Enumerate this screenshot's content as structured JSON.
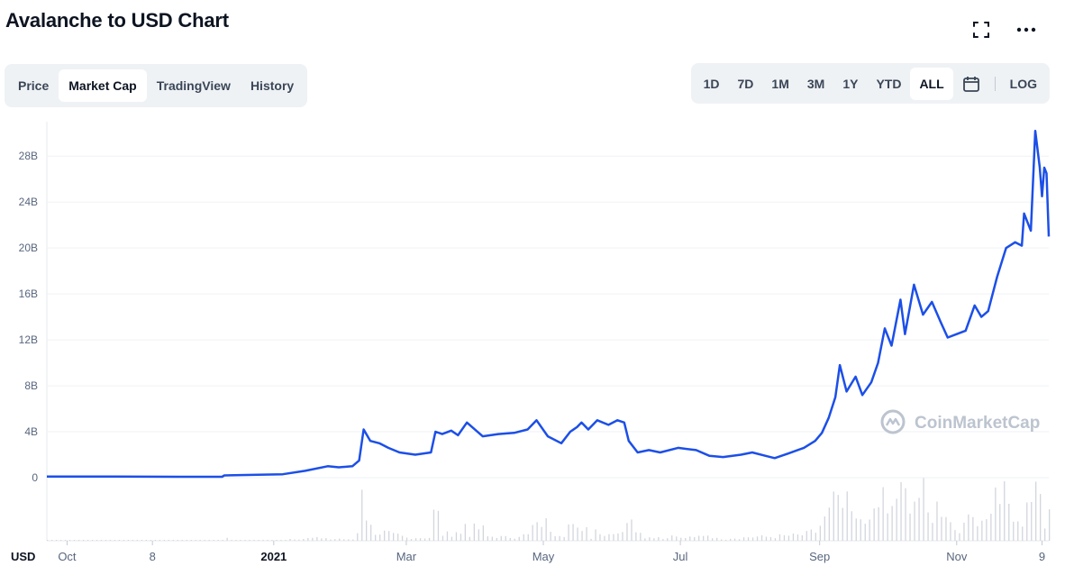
{
  "header": {
    "title": "Avalanche to USD Chart"
  },
  "icons": {
    "fullscreen": "fullscreen-icon",
    "more": "more-icon",
    "calendar": "calendar-icon"
  },
  "tabs": [
    {
      "label": "Price",
      "active": false
    },
    {
      "label": "Market Cap",
      "active": true
    },
    {
      "label": "TradingView",
      "active": false
    },
    {
      "label": "History",
      "active": false
    }
  ],
  "ranges": [
    {
      "label": "1D",
      "active": false
    },
    {
      "label": "7D",
      "active": false
    },
    {
      "label": "1M",
      "active": false
    },
    {
      "label": "3M",
      "active": false
    },
    {
      "label": "1Y",
      "active": false
    },
    {
      "label": "YTD",
      "active": false
    },
    {
      "label": "ALL",
      "active": true
    }
  ],
  "log_label": "LOG",
  "watermark": "CoinMarketCap",
  "colors": {
    "line": "#1c4fe8",
    "volume": "#d2d6dc",
    "grid": "#eff2f5",
    "tab_bg": "#eff2f5"
  },
  "chart_data": {
    "type": "line",
    "currency_label": "USD",
    "y_ticks": [
      "0",
      "4B",
      "8B",
      "12B",
      "16B",
      "20B",
      "24B",
      "28B"
    ],
    "ylim": [
      0,
      31
    ],
    "x_ticks": [
      {
        "label": "Oct",
        "x": "2020-10-01",
        "bold": false
      },
      {
        "label": "8",
        "x": "2020-11-08",
        "bold": false
      },
      {
        "label": "2021",
        "x": "2021-01-01",
        "bold": true
      },
      {
        "label": "Mar",
        "x": "2021-03-01",
        "bold": false
      },
      {
        "label": "May",
        "x": "2021-05-01",
        "bold": false
      },
      {
        "label": "Jul",
        "x": "2021-07-01",
        "bold": false
      },
      {
        "label": "Sep",
        "x": "2021-09-01",
        "bold": false
      },
      {
        "label": "Nov",
        "x": "2021-11-01",
        "bold": false
      },
      {
        "label": "9",
        "x": "2021-12-09",
        "bold": false
      }
    ],
    "x_range": [
      "2020-09-22",
      "2021-12-12"
    ],
    "series": [
      {
        "units": "billions USD",
        "points": [
          [
            "2020-09-22",
            0.1
          ],
          [
            "2020-10-20",
            0.1
          ],
          [
            "2020-11-20",
            0.08
          ],
          [
            "2020-12-09",
            0.08
          ],
          [
            "2020-12-10",
            0.2
          ],
          [
            "2020-12-25",
            0.25
          ],
          [
            "2021-01-05",
            0.3
          ],
          [
            "2021-01-15",
            0.6
          ],
          [
            "2021-01-25",
            1.0
          ],
          [
            "2021-01-30",
            0.9
          ],
          [
            "2021-02-05",
            1.0
          ],
          [
            "2021-02-08",
            1.5
          ],
          [
            "2021-02-10",
            4.2
          ],
          [
            "2021-02-13",
            3.2
          ],
          [
            "2021-02-17",
            3.0
          ],
          [
            "2021-02-21",
            2.6
          ],
          [
            "2021-02-26",
            2.2
          ],
          [
            "2021-03-05",
            2.0
          ],
          [
            "2021-03-12",
            2.2
          ],
          [
            "2021-03-14",
            4.0
          ],
          [
            "2021-03-17",
            3.8
          ],
          [
            "2021-03-21",
            4.1
          ],
          [
            "2021-03-24",
            3.7
          ],
          [
            "2021-03-28",
            4.8
          ],
          [
            "2021-04-04",
            3.6
          ],
          [
            "2021-04-11",
            3.8
          ],
          [
            "2021-04-18",
            3.9
          ],
          [
            "2021-04-24",
            4.2
          ],
          [
            "2021-04-28",
            5.0
          ],
          [
            "2021-05-03",
            3.6
          ],
          [
            "2021-05-09",
            3.0
          ],
          [
            "2021-05-13",
            4.0
          ],
          [
            "2021-05-16",
            4.4
          ],
          [
            "2021-05-18",
            4.8
          ],
          [
            "2021-05-21",
            4.2
          ],
          [
            "2021-05-25",
            5.0
          ],
          [
            "2021-05-30",
            4.6
          ],
          [
            "2021-06-03",
            5.0
          ],
          [
            "2021-06-06",
            4.8
          ],
          [
            "2021-06-08",
            3.2
          ],
          [
            "2021-06-12",
            2.2
          ],
          [
            "2021-06-17",
            2.4
          ],
          [
            "2021-06-22",
            2.2
          ],
          [
            "2021-06-30",
            2.6
          ],
          [
            "2021-07-08",
            2.4
          ],
          [
            "2021-07-14",
            1.9
          ],
          [
            "2021-07-20",
            1.8
          ],
          [
            "2021-07-28",
            2.0
          ],
          [
            "2021-08-02",
            2.2
          ],
          [
            "2021-08-08",
            1.9
          ],
          [
            "2021-08-12",
            1.7
          ],
          [
            "2021-08-18",
            2.1
          ],
          [
            "2021-08-25",
            2.6
          ],
          [
            "2021-08-30",
            3.2
          ],
          [
            "2021-09-02",
            3.9
          ],
          [
            "2021-09-05",
            5.2
          ],
          [
            "2021-09-08",
            7.0
          ],
          [
            "2021-09-10",
            9.8
          ],
          [
            "2021-09-13",
            7.5
          ],
          [
            "2021-09-17",
            8.8
          ],
          [
            "2021-09-20",
            7.2
          ],
          [
            "2021-09-24",
            8.3
          ],
          [
            "2021-09-27",
            10.0
          ],
          [
            "2021-09-30",
            13.0
          ],
          [
            "2021-10-03",
            11.5
          ],
          [
            "2021-10-07",
            15.5
          ],
          [
            "2021-10-09",
            12.5
          ],
          [
            "2021-10-13",
            16.8
          ],
          [
            "2021-10-17",
            14.2
          ],
          [
            "2021-10-21",
            15.3
          ],
          [
            "2021-10-25",
            13.5
          ],
          [
            "2021-10-28",
            12.2
          ],
          [
            "2021-11-01",
            12.5
          ],
          [
            "2021-11-05",
            12.8
          ],
          [
            "2021-11-09",
            15.0
          ],
          [
            "2021-11-12",
            14.0
          ],
          [
            "2021-11-15",
            14.5
          ],
          [
            "2021-11-19",
            17.5
          ],
          [
            "2021-11-23",
            20.0
          ],
          [
            "2021-11-27",
            20.5
          ],
          [
            "2021-11-30",
            20.2
          ],
          [
            "2021-12-01",
            23.0
          ],
          [
            "2021-12-04",
            21.5
          ],
          [
            "2021-12-06",
            30.2
          ],
          [
            "2021-12-08",
            27.0
          ],
          [
            "2021-12-09",
            24.5
          ],
          [
            "2021-12-10",
            27.0
          ],
          [
            "2021-12-11",
            26.5
          ],
          [
            "2021-12-12",
            21.0
          ]
        ]
      }
    ]
  }
}
